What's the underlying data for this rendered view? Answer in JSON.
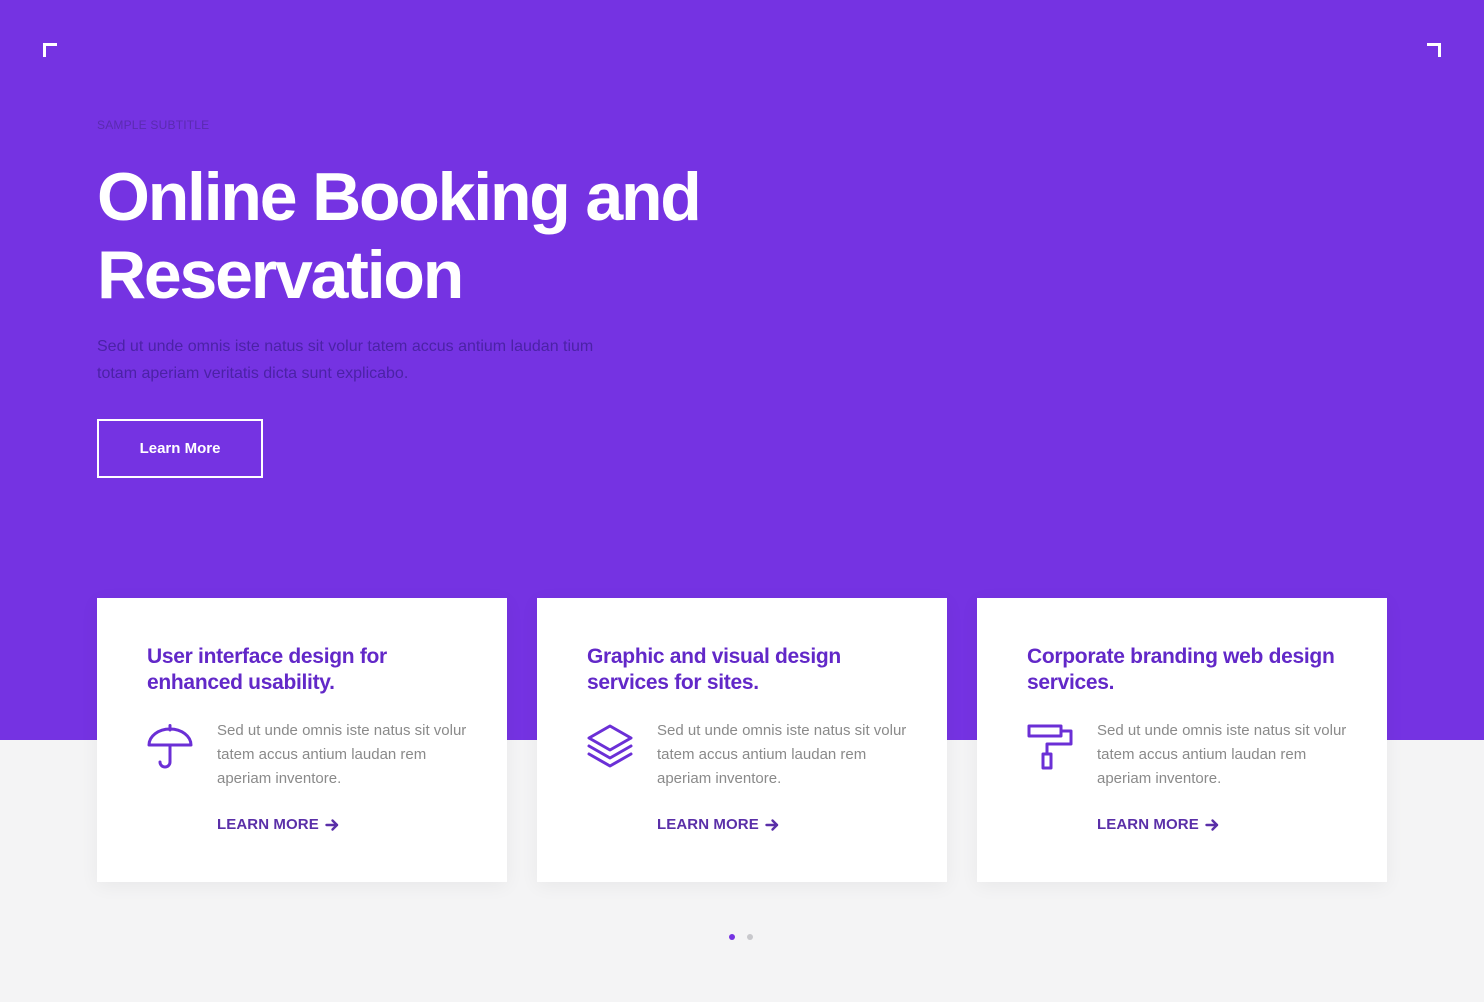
{
  "colors": {
    "accent": "#7533e2",
    "card_title": "#6228c8",
    "background": "#f4f4f5"
  },
  "hero": {
    "subtitle": "SAMPLE SUBTITLE",
    "title": "Online Booking and Reservation",
    "description": "Sed ut unde omnis iste natus sit volur tatem accus antium laudan tium totam aperiam veritatis dicta sunt explicabo.",
    "button_label": "Learn More"
  },
  "cards": [
    {
      "title": "User interface design for enhanced usability.",
      "icon": "umbrella-icon",
      "text": "Sed ut unde omnis iste natus sit volur tatem accus antium laudan rem aperiam inventore.",
      "link_label": "LEARN MORE"
    },
    {
      "title": "Graphic and visual design services for sites.",
      "icon": "layers-icon",
      "text": "Sed ut unde omnis iste natus sit volur tatem accus antium laudan rem aperiam inventore.",
      "link_label": "LEARN MORE"
    },
    {
      "title": "Corporate branding web design services.",
      "icon": "paint-roller-icon",
      "text": "Sed ut unde omnis iste natus sit volur tatem accus antium laudan rem aperiam inventore.",
      "link_label": "LEARN MORE"
    }
  ],
  "pagination": {
    "total": 2,
    "active_index": 0
  }
}
